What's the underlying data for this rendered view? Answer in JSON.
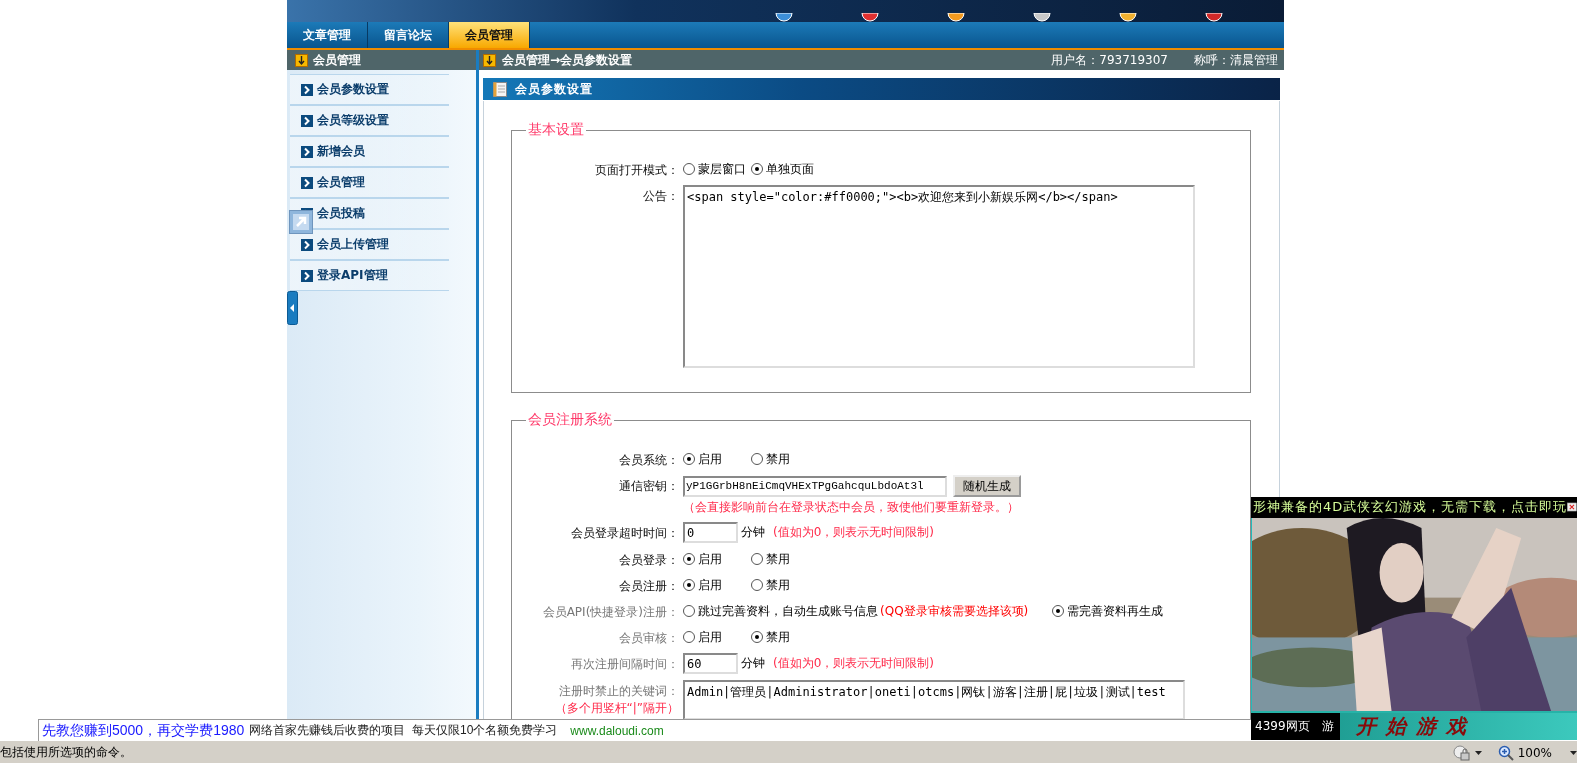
{
  "top_tabs": [
    {
      "label": "文章管理",
      "selected": false
    },
    {
      "label": "留言论坛",
      "selected": false
    },
    {
      "label": "会员管理",
      "selected": true
    }
  ],
  "sidebar": {
    "title": "会员管理",
    "items": [
      {
        "label": "会员参数设置"
      },
      {
        "label": "会员等级设置"
      },
      {
        "label": "新增会员"
      },
      {
        "label": "会员管理"
      },
      {
        "label": "会员投稿"
      },
      {
        "label": "会员上传管理"
      },
      {
        "label": "登录API管理"
      }
    ]
  },
  "breadcrumb": "会员管理→会员参数设置",
  "user": {
    "username": "用户名：793719307",
    "nickname": "称呼：清晨管理"
  },
  "panel_title": "会员参数设置",
  "sections": [
    {
      "legend": "基本设置",
      "rows": [
        {
          "kind": "radio",
          "label": "页面打开模式：",
          "dim": false,
          "options": [
            {
              "label": "蒙层窗口",
              "selected": false
            },
            {
              "label": "单独页面",
              "selected": true
            }
          ]
        },
        {
          "kind": "memo",
          "label": "公告：",
          "dim": false,
          "value": "<span style=\"color:#ff0000;\"><b>欢迎您来到小新娱乐网</b></span>"
        }
      ]
    },
    {
      "legend": "会员注册系统",
      "rows": [
        {
          "kind": "radio",
          "label": "会员系统：",
          "dim": false,
          "options": [
            {
              "label": "启用",
              "selected": true
            },
            {
              "label": "禁用",
              "selected": false
            }
          ]
        },
        {
          "kind": "key",
          "label": "通信密钥：",
          "dim": false,
          "value": "yP1GGrbH8nEiCmqVHExTPgGahcquLbdoAt3l",
          "button": "随机生成",
          "note": "（会直接影响前台在登录状态中会员，致使他们要重新登录。）"
        },
        {
          "kind": "number",
          "label": "会员登录超时时间：",
          "dim": false,
          "value": "0",
          "unit": "分钟",
          "note": "(值如为0，则表示无时间限制)"
        },
        {
          "kind": "radio",
          "label": "会员登录：",
          "dim": false,
          "options": [
            {
              "label": "启用",
              "selected": true
            },
            {
              "label": "禁用",
              "selected": false
            }
          ]
        },
        {
          "kind": "radio",
          "label": "会员注册：",
          "dim": false,
          "options": [
            {
              "label": "启用",
              "selected": true
            },
            {
              "label": "禁用",
              "selected": false
            }
          ]
        },
        {
          "kind": "radio",
          "label": "会员API(快捷登录)注册：",
          "dim": true,
          "options": [
            {
              "label": "跳过完善资料，自动生成账号信息",
              "note": "(QQ登录审核需要选择该项)",
              "selected": false
            },
            {
              "label": "需完善资料再生成",
              "selected": true
            }
          ]
        },
        {
          "kind": "radio",
          "label": "会员审核：",
          "dim": true,
          "options": [
            {
              "label": "启用",
              "selected": false
            },
            {
              "label": "禁用",
              "selected": true
            }
          ]
        },
        {
          "kind": "number",
          "label": "再次注册间隔时间：",
          "dim": true,
          "value": "60",
          "unit": "分钟",
          "note": "(值如为0，则表示无时间限制)"
        },
        {
          "kind": "textarea",
          "label": "注册时禁止的关键词：",
          "hint": "（多个用竖杆“|”隔开）",
          "dim": true,
          "value": "Admin|管理员|Administrator|oneti|otcms|网钛|游客|注册|屁|垃圾|测试|test"
        }
      ]
    }
  ],
  "ad_bar": {
    "headline": "先教您赚到5000，再交学费1980",
    "text": "网络首家先赚钱后收费的项目  每天仅限10个名额免费学习",
    "link": "www.daloudi.com"
  },
  "ad_popup": {
    "ticker": "形神兼备的4D武侠玄幻游戏，无需下载，点击即玩",
    "brand": "4399网页",
    "tag": "游",
    "cta": "开始游戏"
  },
  "status_bar": {
    "message": "包括使用所选项的命令。",
    "zoom": "100%"
  }
}
